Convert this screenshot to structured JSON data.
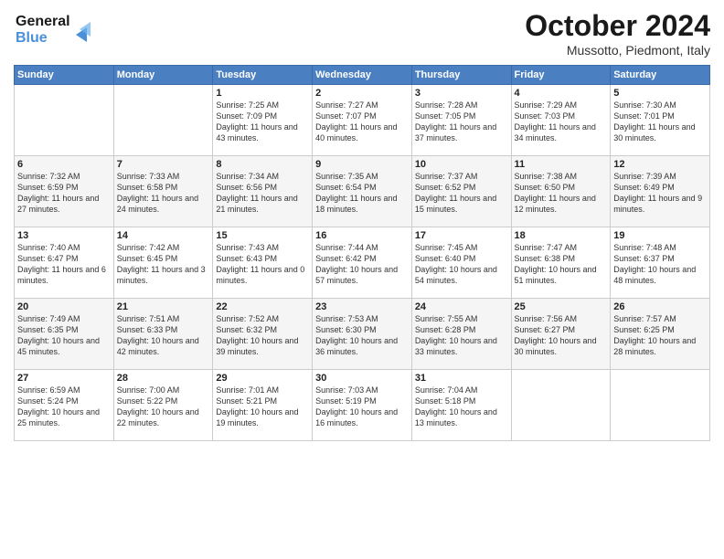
{
  "header": {
    "logo_line1": "General",
    "logo_line2": "Blue",
    "month": "October 2024",
    "location": "Mussotto, Piedmont, Italy"
  },
  "weekdays": [
    "Sunday",
    "Monday",
    "Tuesday",
    "Wednesday",
    "Thursday",
    "Friday",
    "Saturday"
  ],
  "weeks": [
    [
      {
        "day": "",
        "sunrise": "",
        "sunset": "",
        "daylight": ""
      },
      {
        "day": "",
        "sunrise": "",
        "sunset": "",
        "daylight": ""
      },
      {
        "day": "1",
        "sunrise": "Sunrise: 7:25 AM",
        "sunset": "Sunset: 7:09 PM",
        "daylight": "Daylight: 11 hours and 43 minutes."
      },
      {
        "day": "2",
        "sunrise": "Sunrise: 7:27 AM",
        "sunset": "Sunset: 7:07 PM",
        "daylight": "Daylight: 11 hours and 40 minutes."
      },
      {
        "day": "3",
        "sunrise": "Sunrise: 7:28 AM",
        "sunset": "Sunset: 7:05 PM",
        "daylight": "Daylight: 11 hours and 37 minutes."
      },
      {
        "day": "4",
        "sunrise": "Sunrise: 7:29 AM",
        "sunset": "Sunset: 7:03 PM",
        "daylight": "Daylight: 11 hours and 34 minutes."
      },
      {
        "day": "5",
        "sunrise": "Sunrise: 7:30 AM",
        "sunset": "Sunset: 7:01 PM",
        "daylight": "Daylight: 11 hours and 30 minutes."
      }
    ],
    [
      {
        "day": "6",
        "sunrise": "Sunrise: 7:32 AM",
        "sunset": "Sunset: 6:59 PM",
        "daylight": "Daylight: 11 hours and 27 minutes."
      },
      {
        "day": "7",
        "sunrise": "Sunrise: 7:33 AM",
        "sunset": "Sunset: 6:58 PM",
        "daylight": "Daylight: 11 hours and 24 minutes."
      },
      {
        "day": "8",
        "sunrise": "Sunrise: 7:34 AM",
        "sunset": "Sunset: 6:56 PM",
        "daylight": "Daylight: 11 hours and 21 minutes."
      },
      {
        "day": "9",
        "sunrise": "Sunrise: 7:35 AM",
        "sunset": "Sunset: 6:54 PM",
        "daylight": "Daylight: 11 hours and 18 minutes."
      },
      {
        "day": "10",
        "sunrise": "Sunrise: 7:37 AM",
        "sunset": "Sunset: 6:52 PM",
        "daylight": "Daylight: 11 hours and 15 minutes."
      },
      {
        "day": "11",
        "sunrise": "Sunrise: 7:38 AM",
        "sunset": "Sunset: 6:50 PM",
        "daylight": "Daylight: 11 hours and 12 minutes."
      },
      {
        "day": "12",
        "sunrise": "Sunrise: 7:39 AM",
        "sunset": "Sunset: 6:49 PM",
        "daylight": "Daylight: 11 hours and 9 minutes."
      }
    ],
    [
      {
        "day": "13",
        "sunrise": "Sunrise: 7:40 AM",
        "sunset": "Sunset: 6:47 PM",
        "daylight": "Daylight: 11 hours and 6 minutes."
      },
      {
        "day": "14",
        "sunrise": "Sunrise: 7:42 AM",
        "sunset": "Sunset: 6:45 PM",
        "daylight": "Daylight: 11 hours and 3 minutes."
      },
      {
        "day": "15",
        "sunrise": "Sunrise: 7:43 AM",
        "sunset": "Sunset: 6:43 PM",
        "daylight": "Daylight: 11 hours and 0 minutes."
      },
      {
        "day": "16",
        "sunrise": "Sunrise: 7:44 AM",
        "sunset": "Sunset: 6:42 PM",
        "daylight": "Daylight: 10 hours and 57 minutes."
      },
      {
        "day": "17",
        "sunrise": "Sunrise: 7:45 AM",
        "sunset": "Sunset: 6:40 PM",
        "daylight": "Daylight: 10 hours and 54 minutes."
      },
      {
        "day": "18",
        "sunrise": "Sunrise: 7:47 AM",
        "sunset": "Sunset: 6:38 PM",
        "daylight": "Daylight: 10 hours and 51 minutes."
      },
      {
        "day": "19",
        "sunrise": "Sunrise: 7:48 AM",
        "sunset": "Sunset: 6:37 PM",
        "daylight": "Daylight: 10 hours and 48 minutes."
      }
    ],
    [
      {
        "day": "20",
        "sunrise": "Sunrise: 7:49 AM",
        "sunset": "Sunset: 6:35 PM",
        "daylight": "Daylight: 10 hours and 45 minutes."
      },
      {
        "day": "21",
        "sunrise": "Sunrise: 7:51 AM",
        "sunset": "Sunset: 6:33 PM",
        "daylight": "Daylight: 10 hours and 42 minutes."
      },
      {
        "day": "22",
        "sunrise": "Sunrise: 7:52 AM",
        "sunset": "Sunset: 6:32 PM",
        "daylight": "Daylight: 10 hours and 39 minutes."
      },
      {
        "day": "23",
        "sunrise": "Sunrise: 7:53 AM",
        "sunset": "Sunset: 6:30 PM",
        "daylight": "Daylight: 10 hours and 36 minutes."
      },
      {
        "day": "24",
        "sunrise": "Sunrise: 7:55 AM",
        "sunset": "Sunset: 6:28 PM",
        "daylight": "Daylight: 10 hours and 33 minutes."
      },
      {
        "day": "25",
        "sunrise": "Sunrise: 7:56 AM",
        "sunset": "Sunset: 6:27 PM",
        "daylight": "Daylight: 10 hours and 30 minutes."
      },
      {
        "day": "26",
        "sunrise": "Sunrise: 7:57 AM",
        "sunset": "Sunset: 6:25 PM",
        "daylight": "Daylight: 10 hours and 28 minutes."
      }
    ],
    [
      {
        "day": "27",
        "sunrise": "Sunrise: 6:59 AM",
        "sunset": "Sunset: 5:24 PM",
        "daylight": "Daylight: 10 hours and 25 minutes."
      },
      {
        "day": "28",
        "sunrise": "Sunrise: 7:00 AM",
        "sunset": "Sunset: 5:22 PM",
        "daylight": "Daylight: 10 hours and 22 minutes."
      },
      {
        "day": "29",
        "sunrise": "Sunrise: 7:01 AM",
        "sunset": "Sunset: 5:21 PM",
        "daylight": "Daylight: 10 hours and 19 minutes."
      },
      {
        "day": "30",
        "sunrise": "Sunrise: 7:03 AM",
        "sunset": "Sunset: 5:19 PM",
        "daylight": "Daylight: 10 hours and 16 minutes."
      },
      {
        "day": "31",
        "sunrise": "Sunrise: 7:04 AM",
        "sunset": "Sunset: 5:18 PM",
        "daylight": "Daylight: 10 hours and 13 minutes."
      },
      {
        "day": "",
        "sunrise": "",
        "sunset": "",
        "daylight": ""
      },
      {
        "day": "",
        "sunrise": "",
        "sunset": "",
        "daylight": ""
      }
    ]
  ]
}
